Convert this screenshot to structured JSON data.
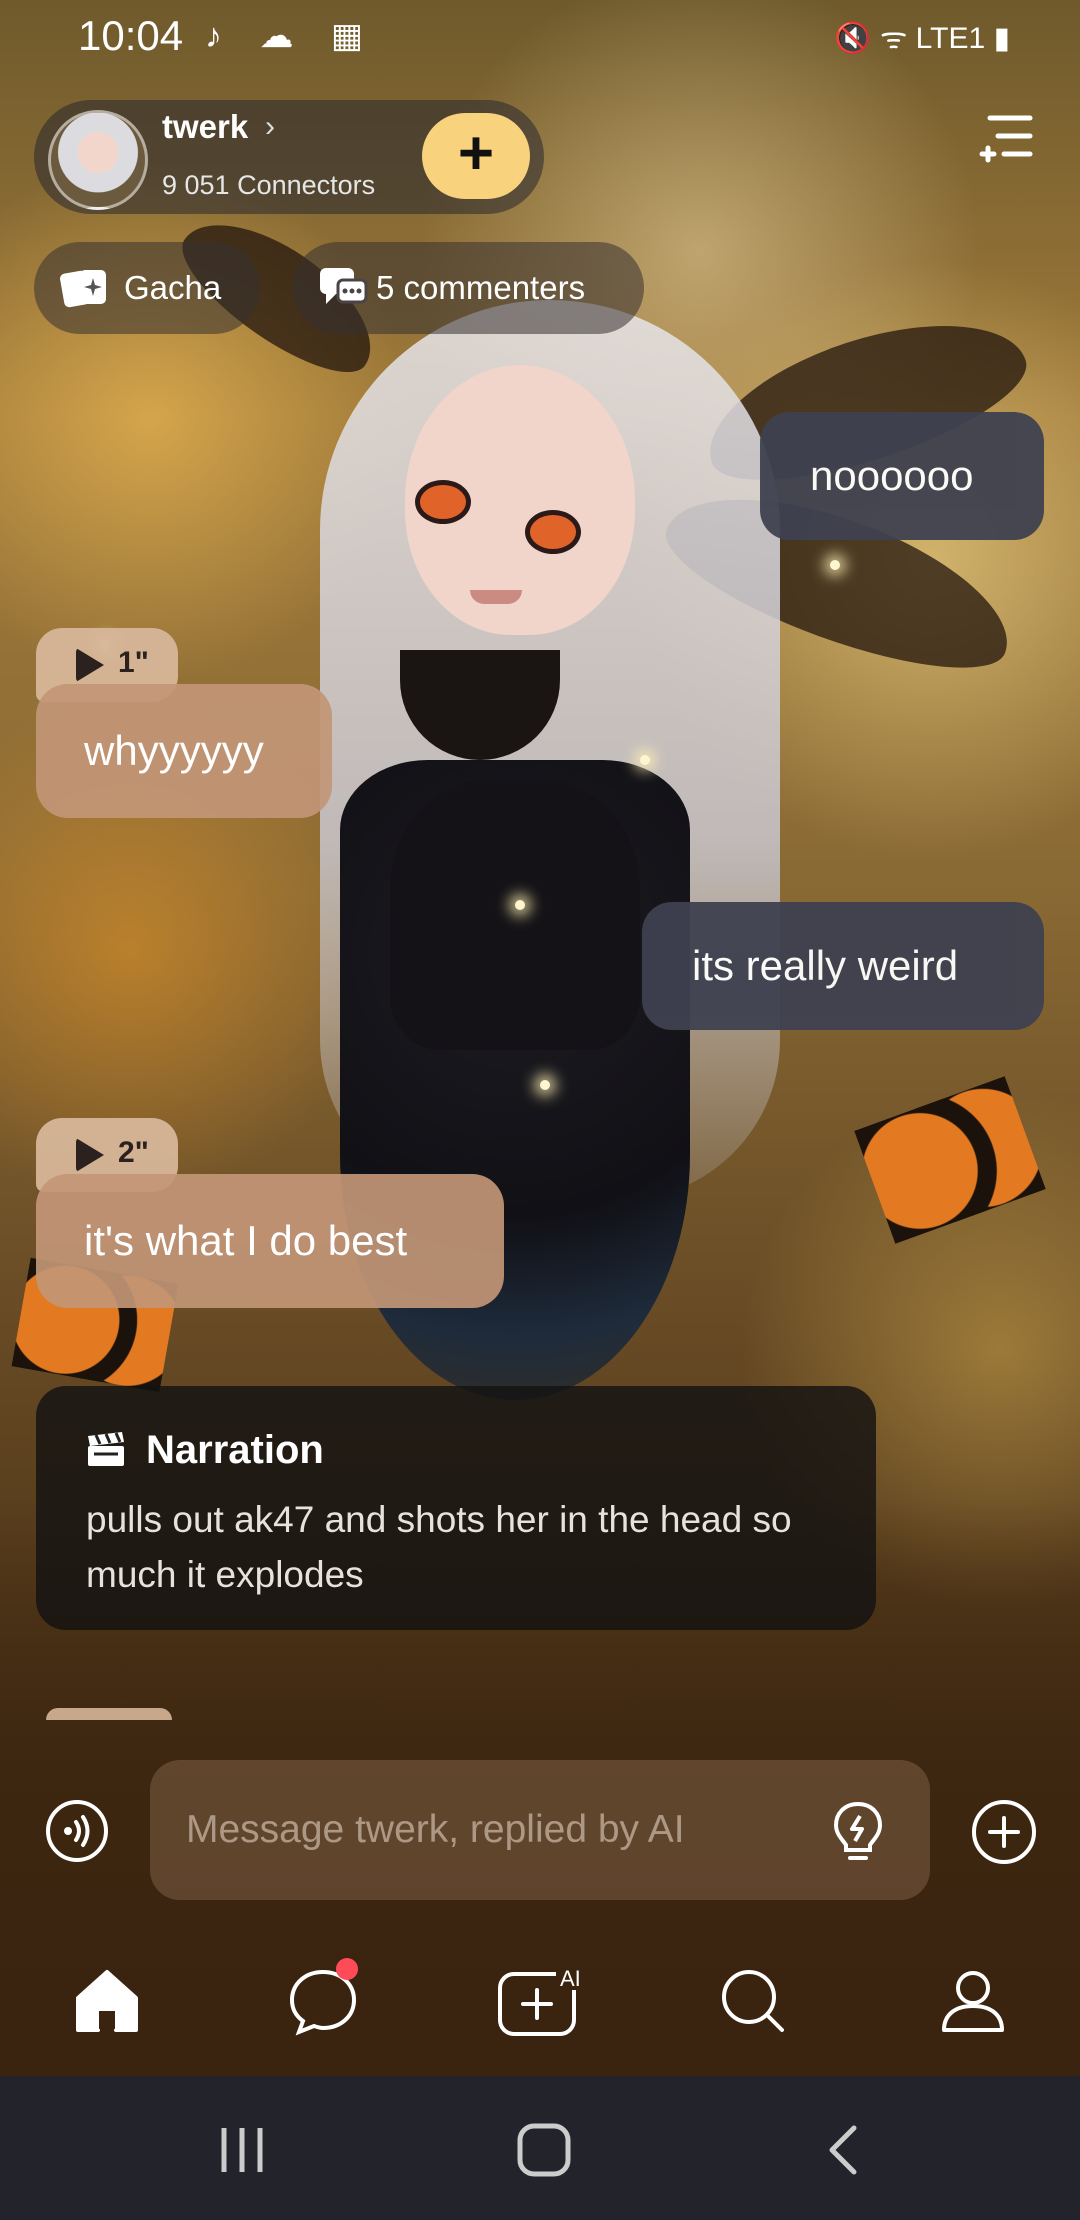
{
  "status_bar": {
    "time": "10:04",
    "left_icons": "♪ ☁ ▦",
    "right_icons": "🔇 ᯤ LTE1 ▮"
  },
  "header": {
    "character_name": "twerk",
    "connectors": "9 051 Connectors",
    "follow_label": "+"
  },
  "chips": {
    "gacha": "Gacha",
    "commenters": "5 commenters"
  },
  "messages": {
    "user_1": "noooooo",
    "ai_1_duration": "1\"",
    "ai_1": "whyyyyyy",
    "user_2": "its really weird",
    "ai_2_duration": "2\"",
    "ai_2": "it's what I do best"
  },
  "narration": {
    "title": "Narration",
    "body": "pulls out ak47 and shots her in the head so much it explodes"
  },
  "composer": {
    "placeholder": "Message twerk, replied by AI"
  },
  "bottom_nav": {
    "ai_badge": "AI",
    "items": [
      "home",
      "chats",
      "create",
      "search",
      "profile"
    ]
  },
  "colors": {
    "accent_yellow": "#f8d27c",
    "user_bubble": "#3f4150",
    "ai_bubble": "#c29676",
    "notification_dot": "#ff4b57"
  }
}
